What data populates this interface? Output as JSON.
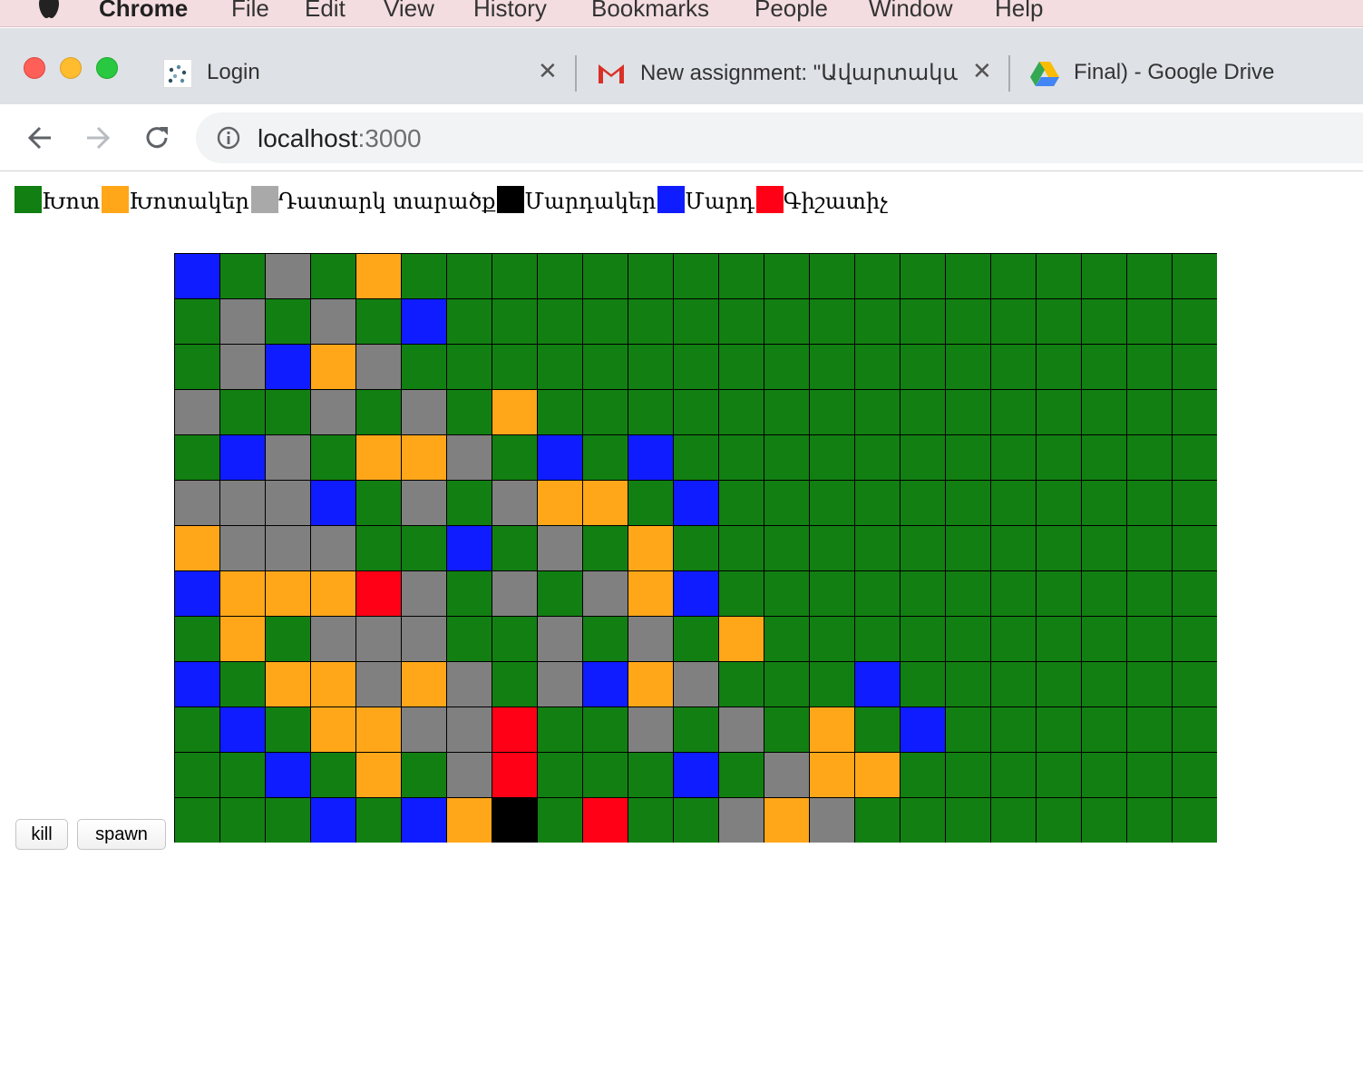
{
  "menubar": {
    "items": [
      "Chrome",
      "File",
      "Edit",
      "View",
      "History",
      "Bookmarks",
      "People",
      "Window",
      "Help"
    ]
  },
  "tabs": [
    {
      "title": "Login",
      "icon": "login-favicon"
    },
    {
      "title": "New assignment: \"Ավարտական",
      "icon": "gmail-icon"
    },
    {
      "title": "Final) - Google Drive",
      "icon": "google-drive-icon"
    }
  ],
  "address": {
    "host": "localhost",
    "port": ":3000"
  },
  "legend": [
    {
      "label": "Խոտ",
      "color": "#127f12"
    },
    {
      "label": "Խոտակեր",
      "color": "#ffa719"
    },
    {
      "label": "Դատարկ տարածք",
      "color": "#a9a9a9"
    },
    {
      "label": "Մարդակեր",
      "color": "#000000"
    },
    {
      "label": "Մարդ",
      "color": "#0f1cff"
    },
    {
      "label": "Գիշատիչ",
      "color": "#ff0016"
    }
  ],
  "buttons": {
    "kill": "kill",
    "spawn": "spawn"
  },
  "palette": {
    "G": "#127f12",
    "Y": "#ffa719",
    "E": "#808080",
    "K": "#000000",
    "B": "#0f1cff",
    "R": "#ff0016"
  },
  "grid": [
    "BGEGYGGGGGGGGGGGGGGGGGG",
    "GEGEGBGGGGGGGGGGGGGGGGG",
    "GEBYEGGGGGGGGGGGGGGGGGG",
    "EGGEGEGYGGGGGGGGGGGGGGG",
    "GBEGYYEGBGBGGGGGGGGGGGG",
    "EEEBGEGEYYGBGGGGGGGGGGG",
    "YEEEGGBGEGYGGGGGGGGGGGG",
    "BYYYREGEGEYBGGGGGGGGGGG",
    "GYGEEEGGEGEGYGGGGGGGGGG",
    "BGYYEYEGEBYEGGGBGGGGGGG",
    "GBGYYEERGGEGEGYGBGGGGGG",
    "GGBGYGERGGGBGEYYGGGGGGG",
    "GGGBGBYKGRGGEYEGGGGGGGG"
  ]
}
